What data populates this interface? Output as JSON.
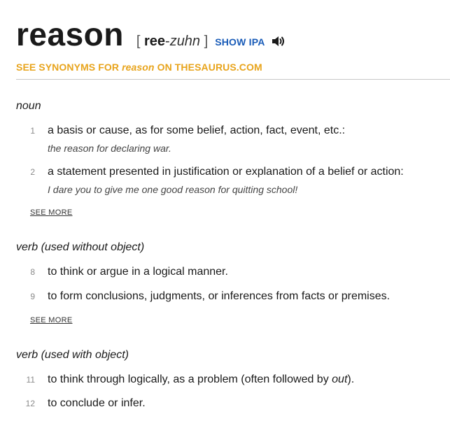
{
  "entry": {
    "word": "reason",
    "pronunciation": {
      "open_bracket": "[",
      "stressed": "ree",
      "hyphen": "-",
      "unstressed": "zuhn",
      "close_bracket": "]"
    },
    "show_ipa_label": "SHOW IPA",
    "speaker_icon": "speaker-icon"
  },
  "synonyms_link": {
    "prefix": "SEE SYNONYMS FOR",
    "word": "reason",
    "suffix": "ON THESAURUS.COM"
  },
  "sections": [
    {
      "pos": "noun",
      "definitions": [
        {
          "num": "1",
          "text": "a basis or cause, as for some belief, action, fact, event, etc.:",
          "example": "the reason for declaring war."
        },
        {
          "num": "2",
          "text": "a statement presented in justification or explanation of a belief or action:",
          "example": "I dare you to give me one good reason for quitting school!"
        }
      ],
      "see_more": "SEE MORE"
    },
    {
      "pos": "verb (used without object)",
      "definitions": [
        {
          "num": "8",
          "text": "to think or argue in a logical manner."
        },
        {
          "num": "9",
          "text": "to form conclusions, judgments, or inferences from facts or premises."
        }
      ],
      "see_more": "SEE MORE"
    },
    {
      "pos": "verb (used with object)",
      "definitions": [
        {
          "num": "11",
          "text_before": "to think through logically, as a problem (often followed by ",
          "text_italic": "out",
          "text_after": ")."
        },
        {
          "num": "12",
          "text": "to conclude or infer."
        }
      ]
    }
  ],
  "colors": {
    "link_blue": "#1a5cb8",
    "synonym_orange": "#e8a41c"
  }
}
